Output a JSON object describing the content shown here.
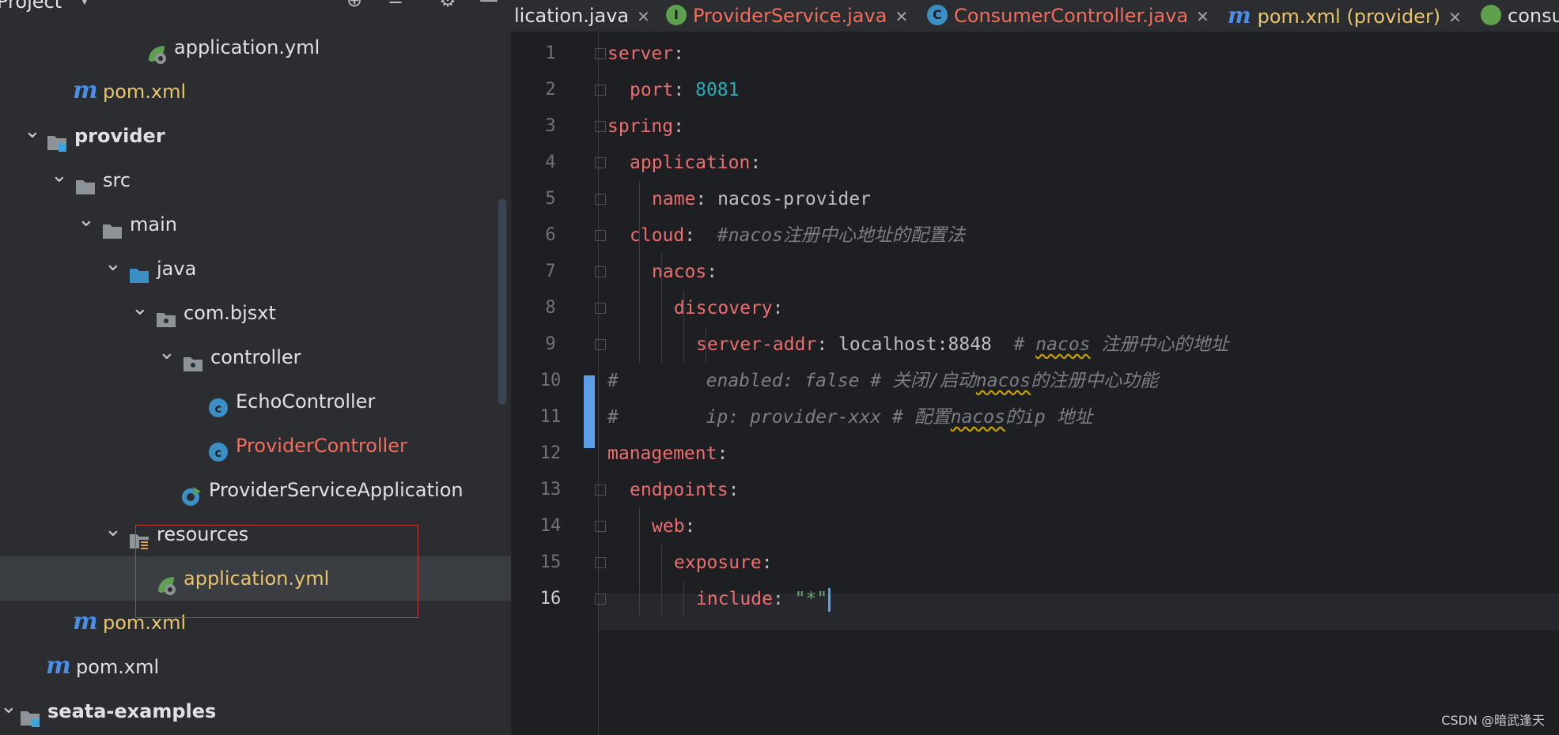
{
  "project": {
    "title": "Project"
  },
  "tree": [
    {
      "label": "application.yml",
      "icon": "spring-config-icon",
      "style": "normal"
    },
    {
      "label": "pom.xml",
      "icon": "maven-icon",
      "style": "yellow"
    },
    {
      "label": "provider",
      "icon": "module-folder-icon",
      "style": "bold"
    },
    {
      "label": "src",
      "icon": "folder-icon",
      "style": "normal"
    },
    {
      "label": "main",
      "icon": "folder-icon",
      "style": "normal"
    },
    {
      "label": "java",
      "icon": "source-folder-icon",
      "style": "normal"
    },
    {
      "label": "com.bjsxt",
      "icon": "package-icon",
      "style": "normal"
    },
    {
      "label": "controller",
      "icon": "package-icon",
      "style": "normal"
    },
    {
      "label": "EchoController",
      "icon": "class-icon",
      "style": "normal"
    },
    {
      "label": "ProviderController",
      "icon": "class-icon",
      "style": "red"
    },
    {
      "label": "ProviderServiceApplication",
      "icon": "spring-boot-class-icon",
      "style": "normal"
    },
    {
      "label": "resources",
      "icon": "resources-folder-icon",
      "style": "normal"
    },
    {
      "label": "application.yml",
      "icon": "spring-config-icon",
      "style": "yellow"
    },
    {
      "label": "pom.xml",
      "icon": "maven-icon",
      "style": "yellow"
    },
    {
      "label": "pom.xml",
      "icon": "maven-icon",
      "style": "normal"
    },
    {
      "label": "seata-examples",
      "icon": "module-folder-icon",
      "style": "bold"
    }
  ],
  "tabs": [
    {
      "label": "lication.java",
      "color": "#dfe1e5"
    },
    {
      "label": "ProviderService.java",
      "color": "#f26d5b",
      "badge": "I"
    },
    {
      "label": "ConsumerController.java",
      "color": "#f26d5b",
      "badge": "C"
    },
    {
      "label": "pom.xml (provider)",
      "color": "#e8c46c",
      "badge": "m"
    },
    {
      "label": "consu",
      "color": "#dfe1e5"
    }
  ],
  "editor": {
    "line_numbers": [
      "1",
      "2",
      "3",
      "4",
      "5",
      "6",
      "7",
      "8",
      "9",
      "10",
      "11",
      "12",
      "13",
      "14",
      "15",
      "16"
    ],
    "lines": [
      {
        "key": "server",
        "sep": ":"
      },
      {
        "key": "port",
        "sep": ": ",
        "value": "8081"
      },
      {
        "key": "spring",
        "sep": ":"
      },
      {
        "key": "application",
        "sep": ":"
      },
      {
        "key": "name",
        "sep": ": ",
        "value": "nacos-provider"
      },
      {
        "key": "cloud",
        "sep": ":  ",
        "comment": "#nacos注册中心地址的配置法"
      },
      {
        "key": "nacos",
        "sep": ":"
      },
      {
        "key": "discovery",
        "sep": ":"
      },
      {
        "key": "server-addr",
        "sep": ": ",
        "value": "localhost:8848",
        "comment_a": "  # ",
        "comment_u": "nacos",
        "comment_b": " 注册中心的地址"
      },
      {
        "comment_a": "#        enabled: false # 关闭/启动",
        "comment_u": "nacos",
        "comment_b": "的注册中心功能"
      },
      {
        "comment_a": "#        ip: provider-xxx # 配置",
        "comment_u": "nacos",
        "comment_b": "的ip 地址"
      },
      {
        "key": "management",
        "sep": ":"
      },
      {
        "key": "endpoints",
        "sep": ":"
      },
      {
        "key": "web",
        "sep": ":"
      },
      {
        "key": "exposure",
        "sep": ":"
      },
      {
        "key": "include",
        "sep": ": ",
        "string": "\"*\""
      }
    ]
  },
  "watermark": "CSDN @暗武逢天"
}
